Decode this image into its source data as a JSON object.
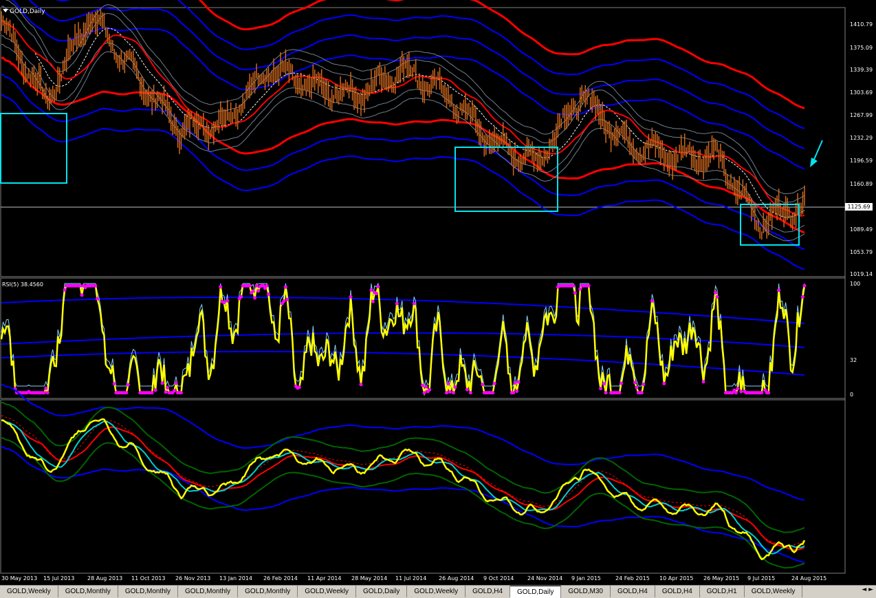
{
  "window": {
    "title": "GOLD,Daily"
  },
  "main_panel": {
    "price_levels": [
      "1410.79",
      "1375.09",
      "1339.39",
      "1303.69",
      "1267.99",
      "1232.29",
      "1196.59",
      "1160.89",
      "1125.69",
      "1089.49",
      "1053.79",
      "1019.14"
    ],
    "current_price": "1125.69"
  },
  "rsi_panel": {
    "label": "RSI(5) 38.4560",
    "levels": [
      "100",
      "32",
      "0"
    ]
  },
  "x_axis": {
    "labels": [
      "30 May 2013",
      "15 Jul 2013",
      "28 Aug 2013",
      "11 Oct 2013",
      "26 Nov 2013",
      "13 Jan 2014",
      "26 Feb 2014",
      "11 Apr 2014",
      "28 May 2014",
      "11 Jul 2014",
      "26 Aug 2014",
      "9 Oct 2014",
      "24 Nov 2014",
      "9 Jan 2015",
      "24 Feb 2015",
      "10 Apr 2015",
      "26 May 2015",
      "9 Jul 2015",
      "24 Aug 2015"
    ]
  },
  "tabs": [
    {
      "label": "GOLD,Weekly",
      "active": false
    },
    {
      "label": "GOLD,Monthly",
      "active": false
    },
    {
      "label": "GOLD,Monthly",
      "active": false
    },
    {
      "label": "GOLD,Monthly",
      "active": false
    },
    {
      "label": "GOLD,Monthly",
      "active": false
    },
    {
      "label": "GOLD,Weekly",
      "active": false
    },
    {
      "label": "GOLD,Daily",
      "active": false
    },
    {
      "label": "GOLD,Weekly",
      "active": false
    },
    {
      "label": "GOLD,H4",
      "active": false
    },
    {
      "label": "GOLD,Daily",
      "active": true
    },
    {
      "label": "GOLD,M30",
      "active": false
    },
    {
      "label": "GOLD,H4",
      "active": false
    },
    {
      "label": "GOLD,H4",
      "active": false
    },
    {
      "label": "GOLD,H1",
      "active": false
    },
    {
      "label": "GOLD,Weekly",
      "active": false
    }
  ],
  "colors": {
    "background": "#000000",
    "candle": "#d2691e",
    "ma_red": "#ff0000",
    "envelope_blue": "#0000ff",
    "band_gray": "#708090",
    "highlight_box": "#00e5ee",
    "rsi_line": "#ffff00",
    "rsi_marker": "#ff00ff",
    "arrow_up": "#1e90ff",
    "arrow_down": "#c71585"
  },
  "annotations": {
    "boxes": 3,
    "pointer_arrow_icon": "cyan-arrow-icon"
  },
  "chart_data": {
    "type": "line",
    "title": "GOLD,Daily",
    "x": [
      "30 May 2013",
      "15 Jul 2013",
      "28 Aug 2013",
      "11 Oct 2013",
      "26 Nov 2013",
      "13 Jan 2014",
      "26 Feb 2014",
      "11 Apr 2014",
      "28 May 2014",
      "11 Jul 2014",
      "26 Aug 2014",
      "9 Oct 2014",
      "24 Nov 2014",
      "9 Jan 2015",
      "24 Feb 2015",
      "10 Apr 2015",
      "26 May 2015",
      "9 Jul 2015",
      "24 Aug 2015"
    ],
    "series": [
      {
        "values": [
          1400,
          1280,
          1410,
          1320,
          1240,
          1250,
          1330,
          1300,
          1290,
          1330,
          1290,
          1220,
          1190,
          1290,
          1220,
          1200,
          1200,
          1100,
          1130
        ]
      }
    ],
    "ylim": [
      1019.14,
      1420
    ]
  }
}
